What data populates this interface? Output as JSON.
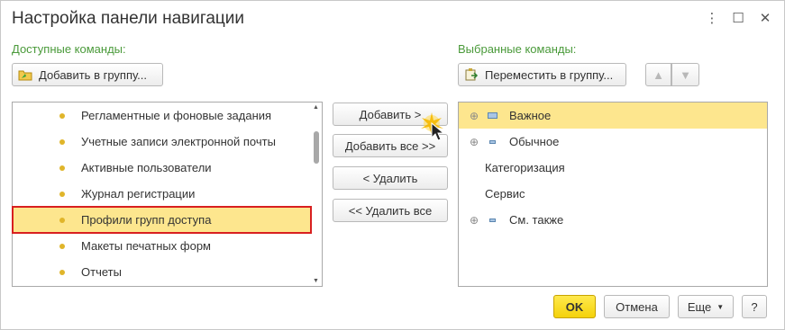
{
  "window": {
    "title": "Настройка панели навигации",
    "more_glyph": "⋮",
    "maximize_glyph": "☐",
    "close_glyph": "✕"
  },
  "available": {
    "label": "Доступные команды:",
    "add_to_group_label": "Добавить в группу...",
    "items": [
      {
        "label": "Регламентные и фоновые задания"
      },
      {
        "label": "Учетные записи электронной почты"
      },
      {
        "label": "Активные пользователи"
      },
      {
        "label": "Журнал регистрации"
      },
      {
        "label": "Профили групп доступа",
        "selected": true
      },
      {
        "label": "Макеты печатных форм"
      },
      {
        "label": "Отчеты"
      }
    ]
  },
  "actions": {
    "add_label": "Добавить >",
    "add_all_label": "Добавить все >>",
    "remove_label": "< Удалить",
    "remove_all_label": "<< Удалить все"
  },
  "selected": {
    "label": "Выбранные команды:",
    "move_to_group_label": "Переместить в группу...",
    "items": [
      {
        "label": "Важное",
        "expand": "⊕",
        "highlighted": true
      },
      {
        "label": "Обычное",
        "expand": "⊕"
      },
      {
        "label": "Категоризация"
      },
      {
        "label": "Сервис"
      },
      {
        "label": "См. также",
        "expand": "⊕"
      }
    ]
  },
  "footer": {
    "ok_label": "OK",
    "cancel_label": "Отмена",
    "more_label": "Еще",
    "help_label": "?"
  },
  "colors": {
    "section_label": "#4a9a3a",
    "selection": "#fde68e",
    "focus_frame": "#d82020",
    "ok_button": "#f4d20a"
  },
  "icons": [
    "add-to-group-icon",
    "move-to-group-icon",
    "move-up-icon",
    "move-down-icon",
    "group-icon",
    "bullet-icon",
    "expand-icon",
    "dropdown-caret-icon",
    "cursor-icon"
  ]
}
